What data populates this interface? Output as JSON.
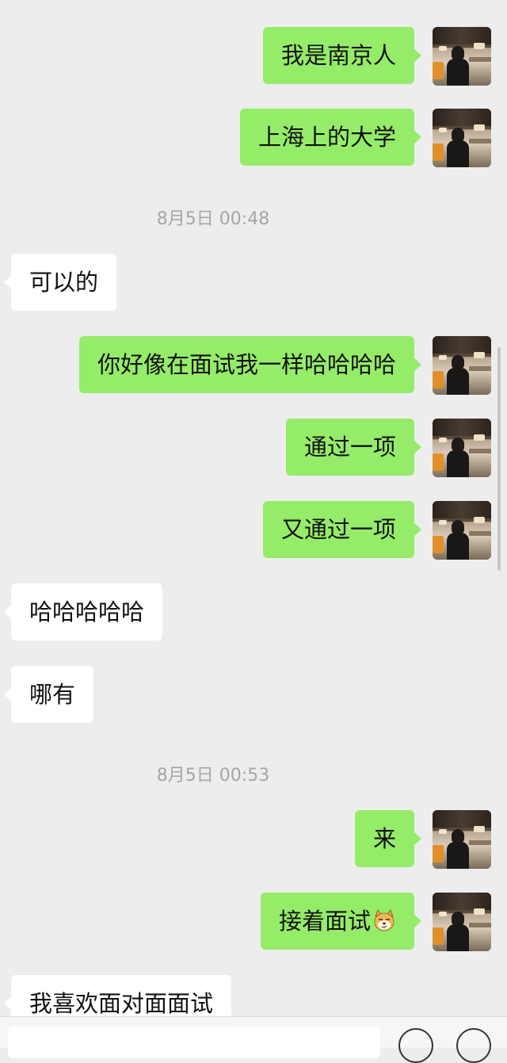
{
  "messages": [
    {
      "type": "out",
      "text": "我是南京人"
    },
    {
      "type": "out",
      "text": "上海上的大学"
    },
    {
      "type": "time",
      "text": "8月5日 00:48"
    },
    {
      "type": "in",
      "text": "可以的"
    },
    {
      "type": "out",
      "text": "你好像在面试我一样哈哈哈哈"
    },
    {
      "type": "out",
      "text": "通过一项"
    },
    {
      "type": "out",
      "text": "又通过一项"
    },
    {
      "type": "in",
      "text": "哈哈哈哈哈"
    },
    {
      "type": "in",
      "text": "哪有"
    },
    {
      "type": "time",
      "text": "8月5日 00:53"
    },
    {
      "type": "out",
      "text": "来"
    },
    {
      "type": "out",
      "text": "接着面试",
      "emoji": "smirking-dog-emoji"
    },
    {
      "type": "in",
      "text": "我喜欢面对面面试"
    }
  ],
  "icons": {
    "avatar": "user-avatar-photo",
    "voice": "voice-input-icon",
    "more": "plus-more-icon"
  },
  "colors": {
    "background": "#ededed",
    "outgoing_bubble": "#95ec69",
    "incoming_bubble": "#ffffff",
    "timestamp": "#a6a6a6"
  }
}
